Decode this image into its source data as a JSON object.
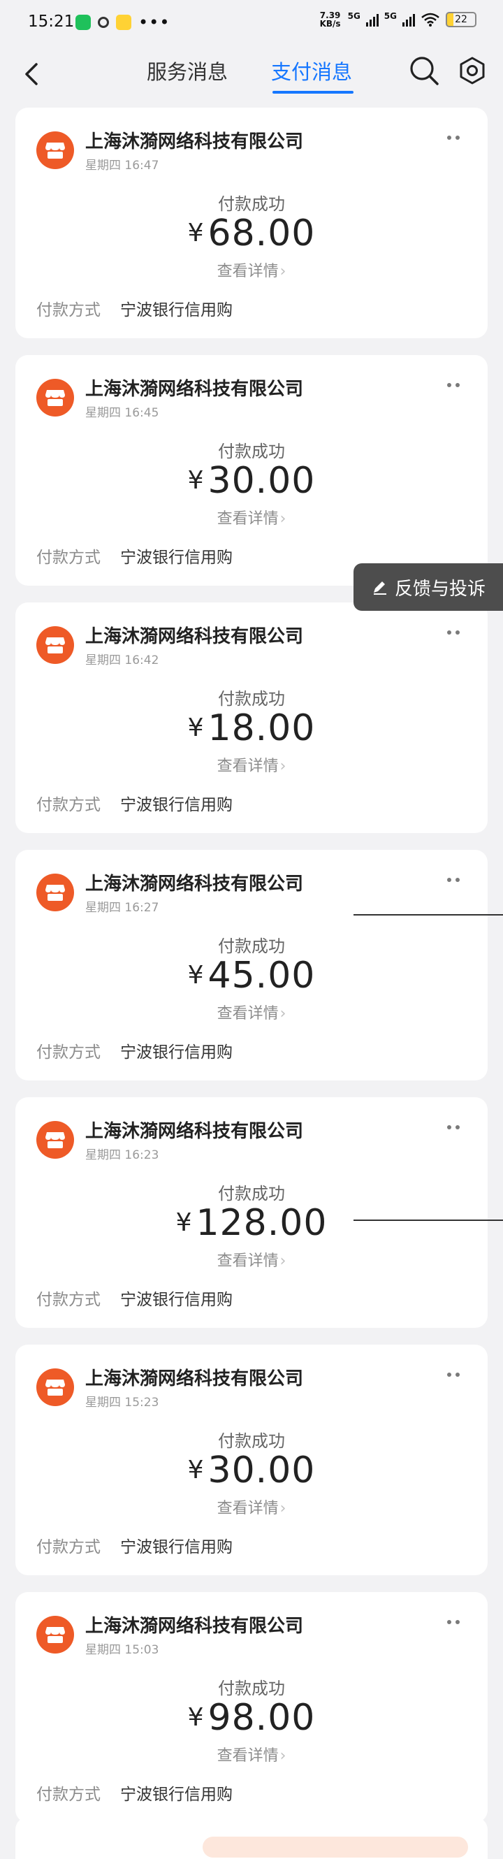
{
  "status_bar": {
    "time": "15:21",
    "net_speed_value": "7.39",
    "net_speed_unit": "KB/s",
    "net_1": "5G",
    "net_2": "5G",
    "battery": "22"
  },
  "nav": {
    "tabs": [
      {
        "label": "服务消息",
        "active": false
      },
      {
        "label": "支付消息",
        "active": true
      }
    ],
    "accent_color": "#1677ff"
  },
  "feedback": {
    "label": "反馈与投诉"
  },
  "labels": {
    "pay_status": "付款成功",
    "currency": "¥",
    "detail": "查看详情",
    "pay_method_label": "付款方式",
    "pay_method_value": "宁波银行信用购"
  },
  "messages": [
    {
      "merchant": "上海沐漪网络科技有限公司",
      "time": "星期四 16:47",
      "amount": "68.00"
    },
    {
      "merchant": "上海沐漪网络科技有限公司",
      "time": "星期四 16:45",
      "amount": "30.00"
    },
    {
      "merchant": "上海沐漪网络科技有限公司",
      "time": "星期四 16:42",
      "amount": "18.00"
    },
    {
      "merchant": "上海沐漪网络科技有限公司",
      "time": "星期四 16:27",
      "amount": "45.00"
    },
    {
      "merchant": "上海沐漪网络科技有限公司",
      "time": "星期四 16:23",
      "amount": "128.00"
    },
    {
      "merchant": "上海沐漪网络科技有限公司",
      "time": "星期四 15:23",
      "amount": "30.00"
    },
    {
      "merchant": "上海沐漪网络科技有限公司",
      "time": "星期四 15:03",
      "amount": "98.00"
    }
  ],
  "merchant_logo_color": "#ee5a27"
}
